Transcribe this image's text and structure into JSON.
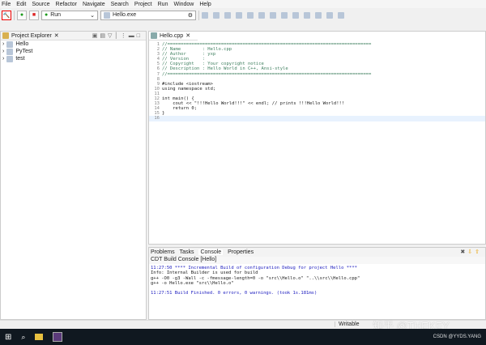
{
  "menu": [
    "File",
    "Edit",
    "Source",
    "Refactor",
    "Navigate",
    "Search",
    "Project",
    "Run",
    "Window",
    "Help"
  ],
  "toolbar": {
    "mode": "Run",
    "target": "Hello.exe"
  },
  "explorer": {
    "title": "Project Explorer",
    "items": [
      "Hello",
      "PyTest",
      "test"
    ]
  },
  "editor": {
    "tab": "Hello.cpp",
    "lines": [
      "//============================================================================",
      "// Name        : Hello.cpp",
      "// Author      : yxp",
      "// Version     :",
      "// Copyright   : Your copyright notice",
      "// Description : Hello World in C++, Ansi-style",
      "//============================================================================",
      "",
      "#include <iostream>",
      "using namespace std;",
      "",
      "int main() {",
      "    cout << \"!!!Hello World!!!\" << endl; // prints !!!Hello World!!!",
      "    return 0;",
      "}",
      ""
    ]
  },
  "bottom": {
    "tabs": [
      "Problems",
      "Tasks",
      "Console",
      "Properties"
    ],
    "console_title": "CDT Build Console [Hello]",
    "output": [
      "11:27:50 **** Incremental Build of configuration Debug for project Hello ****",
      "Info: Internal Builder is used for build",
      "g++ -O0 -g3 -Wall -c -fmessage-length=0 -o \"src\\\\Hello.o\" \"..\\\\src\\\\Hello.cpp\"",
      "g++ -o Hello.exe \"src\\\\Hello.o\"",
      "",
      "11:27:51 Build Finished. 0 errors, 0 warnings. (took 1s.181ms)"
    ]
  },
  "status": {
    "writable": "Writable"
  },
  "watermarks": {
    "zhihu": "知乎 @THEKEY",
    "csdn": "CSDN @YYDS.YANG"
  }
}
